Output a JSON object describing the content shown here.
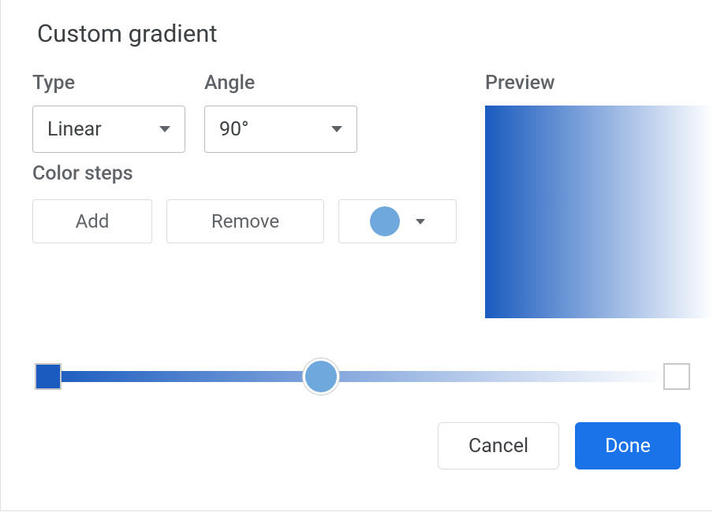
{
  "title": "Custom gradient",
  "labels": {
    "type": "Type",
    "angle": "Angle",
    "color_steps": "Color steps",
    "preview": "Preview"
  },
  "type_select": {
    "value": "Linear"
  },
  "angle_select": {
    "value": "90°"
  },
  "buttons": {
    "add": "Add",
    "remove": "Remove",
    "cancel": "Cancel",
    "done": "Done"
  },
  "colors": {
    "gradient_start": "#1a5bbf",
    "gradient_end": "#ffffff",
    "selected_stop": "#6fa8dc",
    "primary_action": "#1a73e8"
  },
  "slider": {
    "stops": [
      {
        "position": 0,
        "color": "#1a5bbf"
      },
      {
        "position": 100,
        "color": "#ffffff"
      }
    ],
    "thumb_position": 44.5
  }
}
